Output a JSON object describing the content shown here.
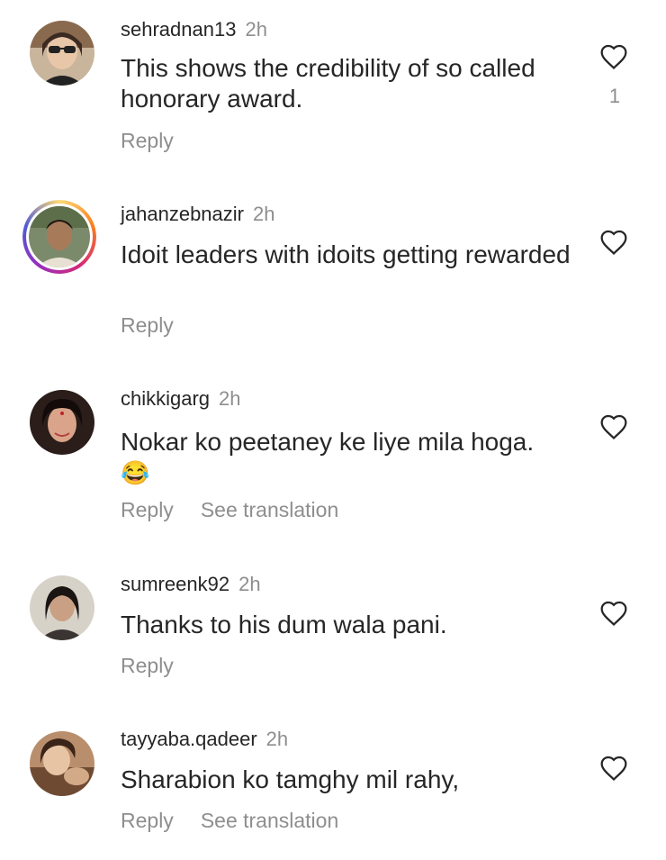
{
  "comments": [
    {
      "username": "sehradnan13",
      "time": "2h",
      "text": "This shows the credibility of so called honorary award.",
      "reply_label": "Reply",
      "likes": "1"
    },
    {
      "username": "jahanzebnazir",
      "time": "2h",
      "text": "Idoit leaders with idoits getting rewarded",
      "reply_label": "Reply"
    },
    {
      "username": "chikkigarg",
      "time": "2h",
      "text": "Nokar ko peetaney ke liye mila hoga.",
      "emoji": "😂",
      "reply_label": "Reply",
      "translation_label": "See translation"
    },
    {
      "username": "sumreenk92",
      "time": "2h",
      "text": "Thanks to his dum wala pani.",
      "reply_label": "Reply"
    },
    {
      "username": "tayyaba.qadeer",
      "time": "2h",
      "text": "Sharabion ko tamghy mil rahy,",
      "reply_label": "Reply",
      "translation_label": "See translation"
    }
  ],
  "icons": {
    "like": "heart-outline-icon",
    "avatar": "profile-photo"
  }
}
